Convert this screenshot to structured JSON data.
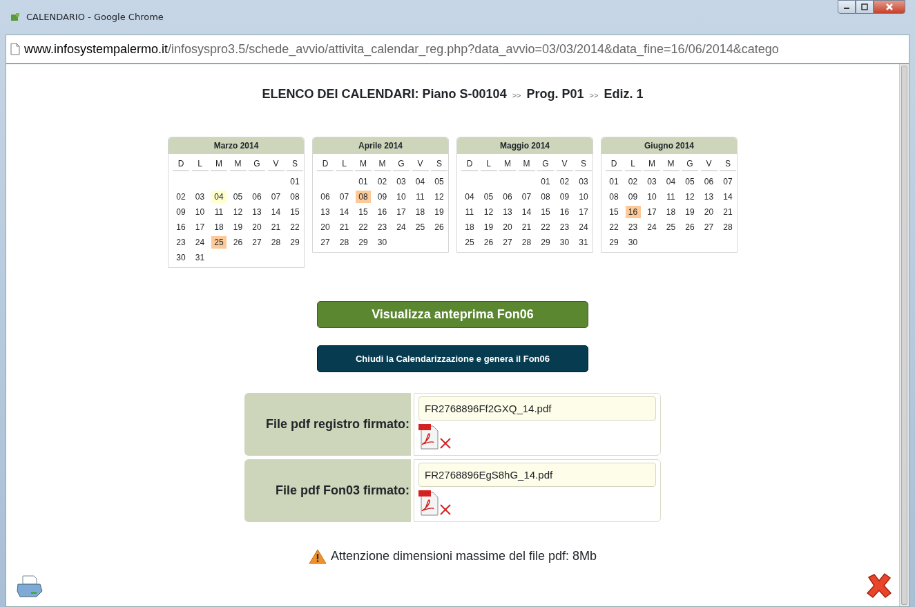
{
  "window": {
    "title": "CALENDARIO - Google Chrome"
  },
  "address_bar": {
    "domain": "www.infosystempalermo.it",
    "path": "/infosyspro3.5/schede_avvio/attivita_calendar_reg.php?data_avvio=03/03/2014&data_fine=16/06/2014&catego"
  },
  "heading": {
    "title": "ELENCO DEI CALENDARI: Piano S-00104",
    "parts": [
      {
        "separator": ">>",
        "text": "Prog. P01"
      },
      {
        "separator": ">>",
        "text": "Ediz. 1"
      }
    ]
  },
  "calendars": [
    {
      "month": "Marzo 2014",
      "weekdays": [
        "D",
        "L",
        "M",
        "M",
        "G",
        "V",
        "S"
      ],
      "weeks": [
        [
          {
            "day": "01"
          }
        ],
        [
          {
            "day": "02"
          },
          {
            "day": "03"
          },
          {
            "day": "04",
            "color": "#ffffcc"
          },
          {
            "day": "05"
          },
          {
            "day": "06"
          },
          {
            "day": "07"
          },
          {
            "day": "08"
          }
        ],
        [
          {
            "day": "09"
          },
          {
            "day": "10"
          },
          {
            "day": "11"
          },
          {
            "day": "12"
          },
          {
            "day": "13"
          },
          {
            "day": "14"
          },
          {
            "day": "15"
          }
        ],
        [
          {
            "day": "16"
          },
          {
            "day": "17"
          },
          {
            "day": "18"
          },
          {
            "day": "19"
          },
          {
            "day": "20"
          },
          {
            "day": "21"
          },
          {
            "day": "22"
          }
        ],
        [
          {
            "day": "23"
          },
          {
            "day": "24"
          },
          {
            "day": "25",
            "color": "#fcc998"
          },
          {
            "day": "26"
          },
          {
            "day": "27"
          },
          {
            "day": "28"
          },
          {
            "day": "29"
          }
        ],
        [
          {
            "day": "30"
          },
          {
            "day": "31"
          }
        ]
      ]
    },
    {
      "month": "Aprile 2014",
      "weekdays": [
        "D",
        "L",
        "M",
        "M",
        "G",
        "V",
        "S"
      ],
      "weeks": [
        [
          {
            "day": "01"
          },
          {
            "day": "02"
          },
          {
            "day": "03"
          },
          {
            "day": "04"
          },
          {
            "day": "05"
          }
        ],
        [
          {
            "day": "06"
          },
          {
            "day": "07"
          },
          {
            "day": "08",
            "color": "#fcc998"
          },
          {
            "day": "09"
          },
          {
            "day": "10"
          },
          {
            "day": "11"
          },
          {
            "day": "12"
          }
        ],
        [
          {
            "day": "13"
          },
          {
            "day": "14"
          },
          {
            "day": "15"
          },
          {
            "day": "16"
          },
          {
            "day": "17"
          },
          {
            "day": "18"
          },
          {
            "day": "19"
          }
        ],
        [
          {
            "day": "20"
          },
          {
            "day": "21"
          },
          {
            "day": "22"
          },
          {
            "day": "23"
          },
          {
            "day": "24"
          },
          {
            "day": "25"
          },
          {
            "day": "26"
          }
        ],
        [
          {
            "day": "27"
          },
          {
            "day": "28"
          },
          {
            "day": "29"
          },
          {
            "day": "30"
          }
        ]
      ]
    },
    {
      "month": "Maggio 2014",
      "weekdays": [
        "D",
        "L",
        "M",
        "M",
        "G",
        "V",
        "S"
      ],
      "weeks": [
        [
          {
            "day": "01"
          },
          {
            "day": "02"
          },
          {
            "day": "03"
          }
        ],
        [
          {
            "day": "04"
          },
          {
            "day": "05"
          },
          {
            "day": "06"
          },
          {
            "day": "07"
          },
          {
            "day": "08"
          },
          {
            "day": "09"
          },
          {
            "day": "10"
          }
        ],
        [
          {
            "day": "11"
          },
          {
            "day": "12"
          },
          {
            "day": "13"
          },
          {
            "day": "14"
          },
          {
            "day": "15"
          },
          {
            "day": "16"
          },
          {
            "day": "17"
          }
        ],
        [
          {
            "day": "18"
          },
          {
            "day": "19"
          },
          {
            "day": "20"
          },
          {
            "day": "21"
          },
          {
            "day": "22"
          },
          {
            "day": "23"
          },
          {
            "day": "24"
          }
        ],
        [
          {
            "day": "25"
          },
          {
            "day": "26"
          },
          {
            "day": "27"
          },
          {
            "day": "28"
          },
          {
            "day": "29"
          },
          {
            "day": "30"
          },
          {
            "day": "31"
          }
        ]
      ]
    },
    {
      "month": "Giugno 2014",
      "weekdays": [
        "D",
        "L",
        "M",
        "M",
        "G",
        "V",
        "S"
      ],
      "weeks": [
        [
          {
            "day": "01"
          },
          {
            "day": "02"
          },
          {
            "day": "03"
          },
          {
            "day": "04"
          },
          {
            "day": "05"
          },
          {
            "day": "06"
          },
          {
            "day": "07"
          }
        ],
        [
          {
            "day": "08"
          },
          {
            "day": "09"
          },
          {
            "day": "10"
          },
          {
            "day": "11"
          },
          {
            "day": "12"
          },
          {
            "day": "13"
          },
          {
            "day": "14"
          }
        ],
        [
          {
            "day": "15"
          },
          {
            "day": "16",
            "color": "#fcc998"
          },
          {
            "day": "17"
          },
          {
            "day": "18"
          },
          {
            "day": "19"
          },
          {
            "day": "20"
          },
          {
            "day": "21"
          }
        ],
        [
          {
            "day": "22"
          },
          {
            "day": "23"
          },
          {
            "day": "24"
          },
          {
            "day": "25"
          },
          {
            "day": "26"
          },
          {
            "day": "27"
          },
          {
            "day": "28"
          }
        ],
        [
          {
            "day": "29"
          },
          {
            "day": "30"
          }
        ]
      ]
    }
  ],
  "buttons": [
    {
      "label": "Visualizza anteprima Fon06",
      "kind": "preview"
    },
    {
      "label": "Chiudi la Calendarizzazione e genera il Fon06",
      "kind": "close"
    }
  ],
  "uploads": [
    {
      "label": "File pdf registro firmato:",
      "filename": "FR2768896Ff2GXQ_14.pdf"
    },
    {
      "label": "File pdf Fon03 firmato:",
      "filename": "FR2768896EgS8hG_14.pdf"
    }
  ],
  "warning": "Attenzione dimensioni massime del file pdf: 8Mb"
}
